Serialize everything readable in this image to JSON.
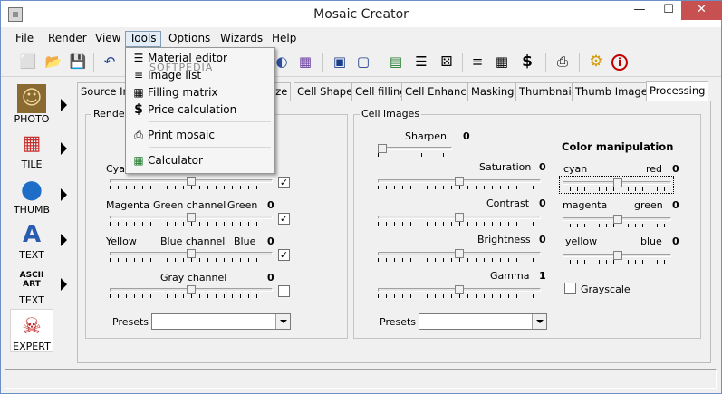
{
  "window": {
    "title": "Mosaic Creator",
    "minimize_glyph": "—",
    "maximize_glyph": "☐",
    "close_glyph": "✕"
  },
  "menubar": {
    "items": [
      "File",
      "Render",
      "View",
      "Tools",
      "Options",
      "Wizards",
      "Help"
    ],
    "active": "Tools"
  },
  "tools_menu": {
    "items": [
      {
        "label": "Material editor",
        "icon": "checklist-icon",
        "glyph": "☰"
      },
      {
        "label": "Image list",
        "icon": "list-icon",
        "glyph": "≡"
      },
      {
        "label": "Filling matrix",
        "icon": "grid-icon",
        "glyph": "▦"
      },
      {
        "label": "Price calculation",
        "icon": "dollar-icon",
        "glyph": "$"
      },
      {
        "label": "Print mosaic",
        "icon": "printer-icon",
        "glyph": "⎙"
      },
      {
        "label": "Calculator",
        "icon": "calculator-icon",
        "glyph": "▦"
      }
    ],
    "watermark": "SOFTPEDIA"
  },
  "toolbar": {
    "buttons": [
      {
        "icon": "new-file-icon",
        "glyph": "⬜"
      },
      {
        "icon": "open-folder-icon",
        "glyph": "📂"
      },
      {
        "icon": "save-icon",
        "glyph": "💾"
      },
      {
        "icon": "undo-icon",
        "glyph": "↶"
      },
      {
        "icon": "palette-icon",
        "glyph": "◐"
      },
      {
        "icon": "mosaic-grid-icon",
        "glyph": "▦"
      },
      {
        "icon": "cube-icon",
        "glyph": "▣"
      },
      {
        "icon": "export-icon",
        "glyph": "▢"
      },
      {
        "icon": "calculator-icon",
        "glyph": "▤"
      },
      {
        "icon": "checklist-icon",
        "glyph": "☰"
      },
      {
        "icon": "dice-icon",
        "glyph": "⚄"
      },
      {
        "icon": "list-icon",
        "glyph": "≡"
      },
      {
        "icon": "matrix-icon",
        "glyph": "▦"
      },
      {
        "icon": "dollar-icon",
        "glyph": "$"
      },
      {
        "icon": "printer-icon",
        "glyph": "⎙"
      },
      {
        "icon": "settings-gear-icon",
        "glyph": "⚙"
      },
      {
        "icon": "info-icon",
        "glyph": "i"
      }
    ]
  },
  "leftnav": {
    "items": [
      {
        "label": "PHOTO",
        "icon": "mona-lisa-photo-icon",
        "glyph": "☺"
      },
      {
        "label": "TILE",
        "icon": "tile-icon",
        "glyph": "▦"
      },
      {
        "label": "THUMB",
        "icon": "globe-icon",
        "glyph": "●"
      },
      {
        "label": "TEXT",
        "icon": "letter-a-icon",
        "glyph": "A"
      },
      {
        "label": "TEXT",
        "icon": "ascii-art-icon",
        "glyph": "ASCII ART"
      },
      {
        "label": "EXPERT",
        "icon": "expert-creature-icon",
        "glyph": "☠"
      }
    ],
    "selected": "EXPERT"
  },
  "tabs": {
    "items": [
      "Source Im",
      "ize",
      "Cell Shape",
      "Cell filling",
      "Cell Enhance",
      "Masking",
      "Thumbnail",
      "Thumb Images",
      "Processing"
    ],
    "active": "Processing"
  },
  "render_group": {
    "title": "Render",
    "rows": [
      {
        "left": "Cya",
        "center": "",
        "right": "",
        "value": "",
        "checked": true
      },
      {
        "left": "Magenta",
        "center": "Green channel",
        "right": "Green",
        "value": "0",
        "checked": true
      },
      {
        "left": "Yellow",
        "center": "Blue channel",
        "right": "Blue",
        "value": "0",
        "checked": true
      },
      {
        "left": "",
        "center": "Gray channel",
        "right": "",
        "value": "0",
        "checked": false
      }
    ],
    "presets_label": "Presets",
    "presets_value": ""
  },
  "cell_images_group": {
    "title": "Cell images",
    "sharpen": {
      "label": "Sharpen",
      "value": "0"
    },
    "adjustments": [
      {
        "label": "Saturation",
        "value": "0"
      },
      {
        "label": "Contrast",
        "value": "0"
      },
      {
        "label": "Brightness",
        "value": "0"
      },
      {
        "label": "Gamma",
        "value": "1"
      }
    ],
    "presets_label": "Presets",
    "presets_value": ""
  },
  "color_manipulation": {
    "title": "Color manipulation",
    "rows": [
      {
        "left": "cyan",
        "right": "red",
        "value": "0"
      },
      {
        "left": "magenta",
        "right": "green",
        "value": "0"
      },
      {
        "left": "yellow",
        "right": "blue",
        "value": "0"
      }
    ],
    "grayscale_label": "Grayscale",
    "grayscale_checked": false
  }
}
